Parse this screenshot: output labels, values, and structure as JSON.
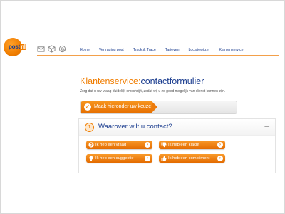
{
  "brand": {
    "logo_text_a": "post",
    "logo_text_b": "nl"
  },
  "header": {
    "icons": [
      "mail-icon",
      "package-icon",
      "at-icon"
    ]
  },
  "nav": {
    "items": [
      {
        "label": "Home"
      },
      {
        "label": "Vertraging post"
      },
      {
        "label": "Track & Trace"
      },
      {
        "label": "Tarieven"
      },
      {
        "label": "Locatiewijzer"
      },
      {
        "label": "Klantenservice"
      }
    ]
  },
  "page": {
    "title_part1": "Klantenservice:",
    "title_part2": "contactformulier",
    "subtitle": "Zorg dat u uw vraag duidelijk omschrijft, zodat wij u zo goed mogelijk van dienst kunnen zijn."
  },
  "stepbar": {
    "step_label": "Maak hieronder uw keuze",
    "check_glyph": "✓"
  },
  "question": {
    "number": "1",
    "text": "Waarover wilt u contact?",
    "collapse_glyph": "–"
  },
  "options": [
    {
      "label": "Ik heb een vraag",
      "icon": "question-icon"
    },
    {
      "label": "Ik heb een klacht",
      "icon": "thumbs-down-icon"
    },
    {
      "label": "Ik heb een suggestie",
      "icon": "lightbulb-icon"
    },
    {
      "label": "Ik heb een compliment",
      "icon": "thumbs-up-icon"
    }
  ],
  "colors": {
    "brand_orange": "#f07d00",
    "brand_blue": "#1b3d8f"
  }
}
